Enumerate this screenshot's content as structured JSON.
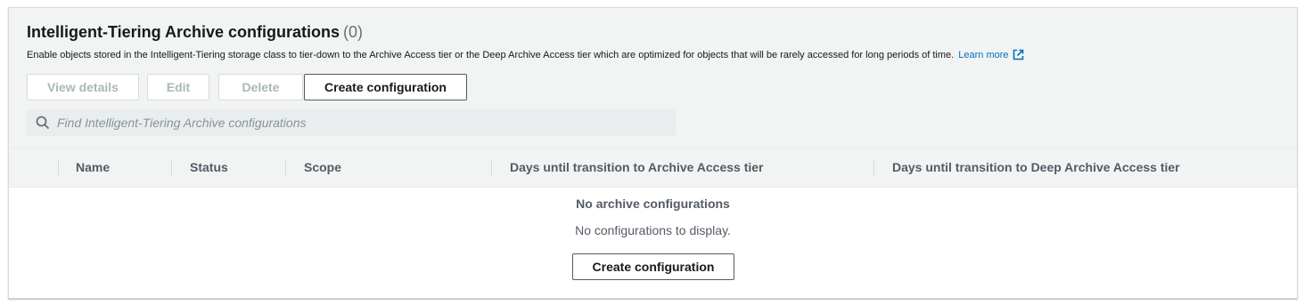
{
  "section": {
    "title": "Intelligent-Tiering Archive configurations",
    "count": "(0)",
    "description": "Enable objects stored in the Intelligent-Tiering storage class to tier-down to the Archive Access tier or the Deep Archive Access tier which are optimized for objects that will be rarely accessed for long periods of time.",
    "learn_more": "Learn more",
    "learn_more_icon": "external-link-icon"
  },
  "toolbar": {
    "view_details": "View details",
    "edit": "Edit",
    "delete": "Delete",
    "create": "Create configuration"
  },
  "search": {
    "placeholder": "Find Intelligent-Tiering Archive configurations",
    "value": "",
    "icon": "search-icon"
  },
  "table": {
    "columns": [
      "Name",
      "Status",
      "Scope",
      "Days until transition to Archive Access tier",
      "Days until transition to Deep Archive Access tier"
    ],
    "rows": []
  },
  "empty_state": {
    "title": "No archive configurations",
    "description": "No configurations to display.",
    "button": "Create configuration"
  },
  "colors": {
    "link": "#0073bb",
    "header_bg": "#f2f3f3",
    "disabled_text": "#aab7b8",
    "primary_border": "#545b64"
  }
}
